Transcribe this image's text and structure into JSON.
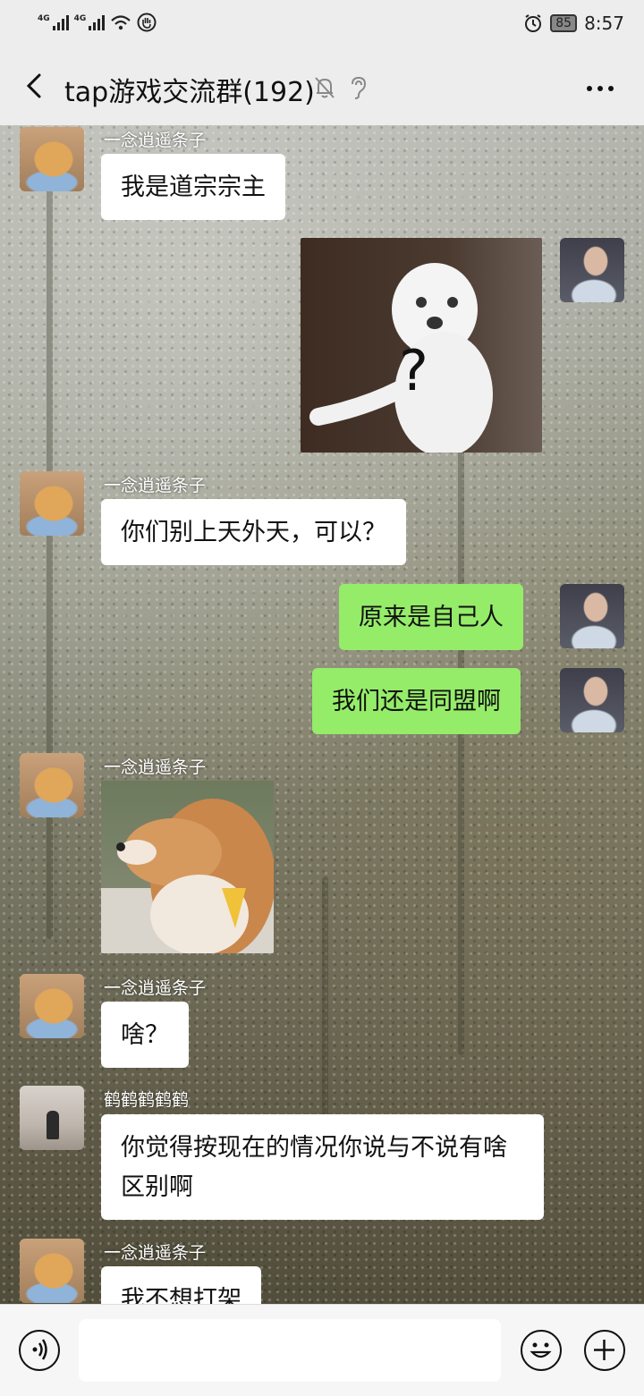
{
  "status": {
    "network1": "4G",
    "network2": "4G",
    "battery": "85",
    "time": "8:57"
  },
  "header": {
    "title": "tap游戏交流群(192)"
  },
  "messages": [
    {
      "sender": "一念逍遥条子",
      "text": "我是道宗宗主"
    },
    {
      "sender": "",
      "text": ""
    },
    {
      "sender": "一念逍遥条子",
      "text": "你们别上天外天，可以？"
    },
    {
      "sender": "",
      "text": "原来是自己人"
    },
    {
      "sender": "",
      "text": "我们还是同盟啊"
    },
    {
      "sender": "一念逍遥条子",
      "text": ""
    },
    {
      "sender": "一念逍遥条子",
      "text": "啥？"
    },
    {
      "sender": "鹤鹤鹤鹤鹤",
      "text": "你觉得按现在的情况你说与不说有啥区别啊"
    },
    {
      "sender": "一念逍遥条子",
      "text": "我不想打架"
    }
  ],
  "stickers": {
    "dog_question_mark": "?"
  },
  "icons": [
    "back-arrow-icon",
    "mute-bell-icon",
    "ear-icon",
    "more-dots-icon",
    "voice-icon",
    "emoji-icon",
    "plus-icon"
  ]
}
